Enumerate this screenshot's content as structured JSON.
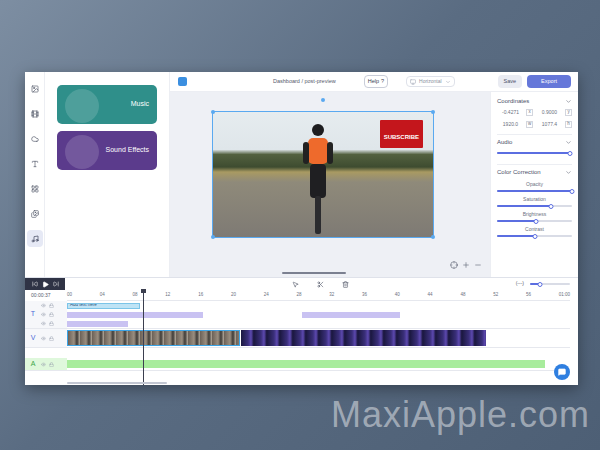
{
  "app": {
    "breadcrumb": "Dashboard / post-preview",
    "help": "Help",
    "help_icon": "?",
    "orientation": "Horizontal",
    "buttons": [
      "Save",
      "Export"
    ]
  },
  "rail": [
    {
      "selected": false
    },
    {
      "selected": false
    },
    {
      "selected": false
    },
    {
      "selected": false
    },
    {
      "selected": false
    },
    {
      "selected": false
    },
    {
      "selected": true
    }
  ],
  "library": [
    {
      "label": "Music",
      "color": "#2f8f8a"
    },
    {
      "label": "Sound Effects",
      "color": "#5b3b8c"
    }
  ],
  "canvas": {
    "overlay": "SUBSCRIBE"
  },
  "properties": {
    "coordinates": {
      "title": "Coordinates",
      "fields": [
        {
          "value": "-0.4271",
          "label": "x"
        },
        {
          "value": "0.9000",
          "label": "y"
        },
        {
          "value": "1920.0",
          "label": "w"
        },
        {
          "value": "1077.4",
          "label": "h"
        }
      ]
    },
    "audio": {
      "title": "Audio",
      "level": 0.97
    },
    "color_correction": {
      "title": "Color Correction",
      "sliders": [
        {
          "label": "Opacity",
          "level": 1
        },
        {
          "label": "Saturation",
          "level": 0.72
        },
        {
          "label": "Brightness",
          "level": 0.52
        },
        {
          "label": "Contrast",
          "level": 0.5
        }
      ]
    }
  },
  "timeline": {
    "time": "00:00:37",
    "fit": "(---)",
    "zoom_level": 0.25,
    "playhead": 9.1,
    "ticks": [
      "00",
      "04",
      "08",
      "12",
      "16",
      "20",
      "24",
      "28",
      "32",
      "36",
      "40",
      "44",
      "48",
      "52",
      "56",
      "01:00"
    ],
    "tracks": [
      {
        "letter": "T",
        "lanes": [
          [
            {
              "kind": "caption",
              "text": "Add text here",
              "start": 0,
              "end": 8.7
            }
          ],
          [
            {
              "kind": "text",
              "start": 0,
              "end": 16.2
            },
            {
              "kind": "text",
              "start": 28,
              "end": 39.7
            }
          ],
          [
            {
              "kind": "text",
              "start": 0,
              "end": 7.3
            }
          ]
        ]
      },
      {
        "letter": "V",
        "lanes": [
          [
            {
              "kind": "video-photo",
              "start": 0,
              "end": 20.6
            },
            {
              "kind": "video-dark",
              "start": 20.8,
              "end": 50
            }
          ]
        ]
      },
      {
        "letter": "A",
        "lanes": [
          [
            {
              "kind": "audio",
              "start": 0,
              "end": 57
            }
          ]
        ]
      }
    ]
  },
  "watermark": "MaxiApple.com"
}
